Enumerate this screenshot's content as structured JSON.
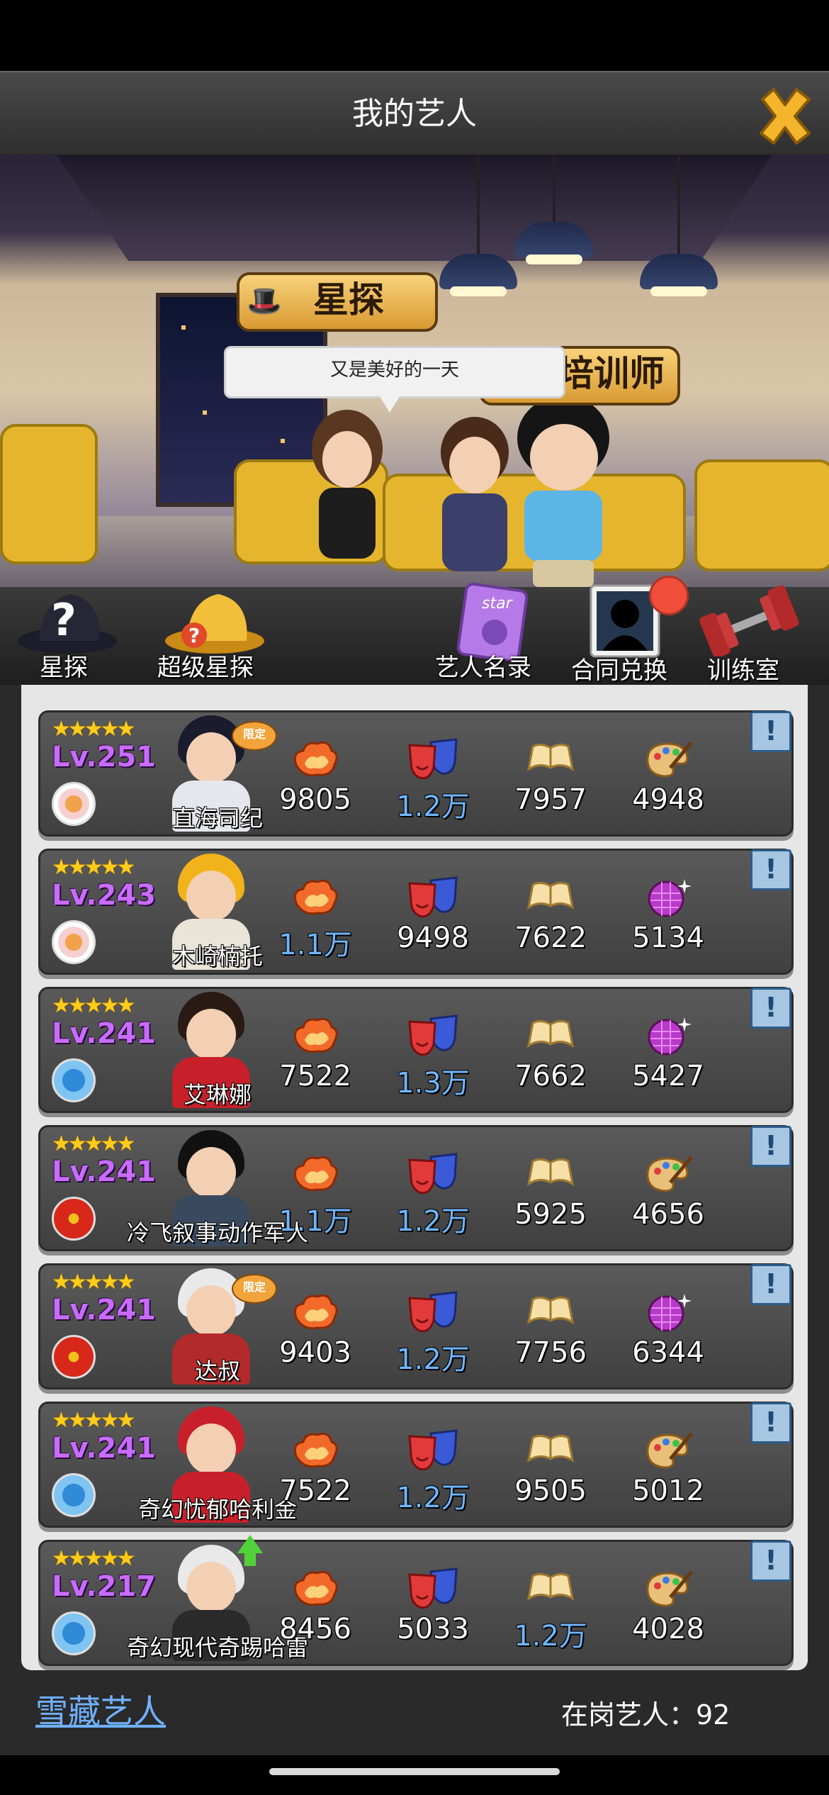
{
  "header": {
    "title": "我的艺人"
  },
  "scene": {
    "sign_scout": "星探",
    "sign_trainer": "培训师",
    "speech": "又是美好的一天"
  },
  "toolbar": [
    {
      "label": "星探",
      "icon": "scout-hat-icon"
    },
    {
      "label": "超级星探",
      "icon": "super-scout-hat-icon"
    },
    {
      "label": "艺人名录",
      "icon": "star-catalog-icon"
    },
    {
      "label": "合同兑换",
      "icon": "silhouette-portrait-icon",
      "notification": true
    },
    {
      "label": "训练室",
      "icon": "dumbbell-icon"
    }
  ],
  "artists": [
    {
      "name": "直海司纪",
      "level": "Lv.251",
      "stars": "★★★★★",
      "limited": "限定",
      "badge": "flower",
      "stats": [
        "9805",
        "1.2万",
        "7957",
        "4948"
      ],
      "hi": [
        false,
        true,
        false,
        false
      ],
      "icon4": "palette"
    },
    {
      "name": "木崎楠托",
      "level": "Lv.243",
      "stars": "★★★★★",
      "limited": "",
      "badge": "flower",
      "stats": [
        "1.1万",
        "9498",
        "7622",
        "5134"
      ],
      "hi": [
        true,
        false,
        false,
        false
      ],
      "icon4": "discoball"
    },
    {
      "name": "艾琳娜",
      "level": "Lv.241",
      "stars": "★★★★★",
      "limited": "",
      "badge": "blue",
      "stats": [
        "7522",
        "1.3万",
        "7662",
        "5427"
      ],
      "hi": [
        false,
        true,
        false,
        false
      ],
      "icon4": "discoball"
    },
    {
      "name": "冷飞叙事动作军人",
      "level": "Lv.241",
      "stars": "★★★★★",
      "limited": "",
      "badge": "red",
      "stats": [
        "1.1万",
        "1.2万",
        "5925",
        "4656"
      ],
      "hi": [
        true,
        true,
        false,
        false
      ],
      "icon4": "palette"
    },
    {
      "name": "达叔",
      "level": "Lv.241",
      "stars": "★★★★★",
      "limited": "限定",
      "badge": "red",
      "stats": [
        "9403",
        "1.2万",
        "7756",
        "6344"
      ],
      "hi": [
        false,
        true,
        false,
        false
      ],
      "icon4": "discoball"
    },
    {
      "name": "奇幻忧郁哈利金",
      "level": "Lv.241",
      "stars": "★★★★★",
      "limited": "",
      "badge": "blue",
      "stats": [
        "7522",
        "1.2万",
        "9505",
        "5012"
      ],
      "hi": [
        false,
        true,
        false,
        false
      ],
      "icon4": "palette"
    },
    {
      "name": "奇幻现代奇踢哈雷",
      "level": "Lv.217",
      "stars": "★★★★★",
      "limited": "",
      "badge": "blue",
      "up": true,
      "stats": [
        "8456",
        "5033",
        "1.2万",
        "4028"
      ],
      "hi": [
        false,
        false,
        true,
        false
      ],
      "icon4": "palette"
    }
  ],
  "info_glyph": "!",
  "footer": {
    "vault": "雪藏艺人",
    "count_label": "在岗艺人：92"
  },
  "colors": {
    "level": "#c86cff",
    "highlight": "#6fb6ff",
    "star": "#ffcc1a"
  }
}
